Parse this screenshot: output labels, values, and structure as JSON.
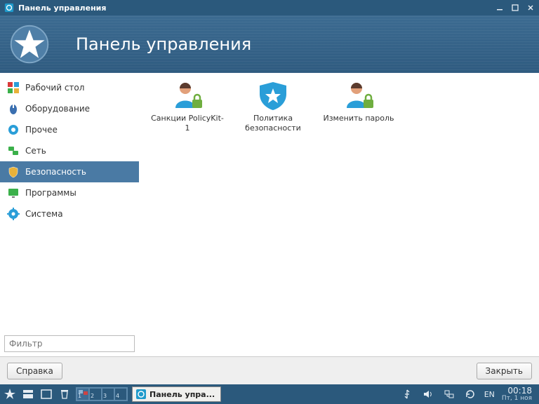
{
  "titlebar": {
    "title": "Панель управления"
  },
  "header": {
    "title": "Панель управления"
  },
  "sidebar": {
    "items": [
      {
        "label": "Рабочий стол"
      },
      {
        "label": "Оборудование"
      },
      {
        "label": "Прочее"
      },
      {
        "label": "Сеть"
      },
      {
        "label": "Безопасность"
      },
      {
        "label": "Программы"
      },
      {
        "label": "Система"
      }
    ],
    "active_index": 4,
    "filter_placeholder": "Фильтр"
  },
  "content": {
    "items": [
      {
        "label": "Санкции PolicyKit-1"
      },
      {
        "label": "Политика безопасности"
      },
      {
        "label": "Изменить пароль"
      }
    ]
  },
  "footer": {
    "help": "Справка",
    "close": "Закрыть"
  },
  "taskbar": {
    "app_label": "Панель упра...",
    "lang": "EN",
    "time": "00:18",
    "date": "Пт, 1 ноя",
    "workspaces": [
      "1",
      "2",
      "3",
      "4"
    ]
  }
}
